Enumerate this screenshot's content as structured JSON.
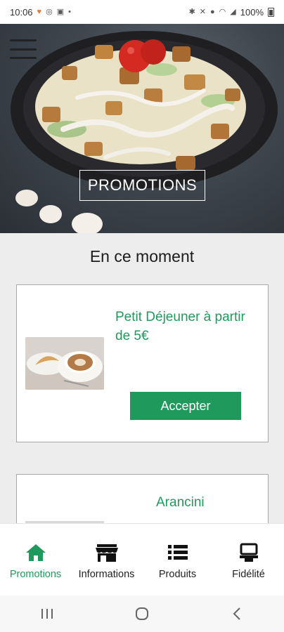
{
  "status_bar": {
    "time": "10:06",
    "battery": "100%",
    "left_icons": [
      "heart-icon",
      "whatsapp-icon",
      "image-icon",
      "dot-icon"
    ],
    "right_icons": [
      "bluetooth-icon",
      "mute-icon",
      "location-icon",
      "wifi-icon",
      "signal-icon",
      "battery-icon"
    ]
  },
  "hero": {
    "title": "PROMOTIONS",
    "menu_icon": "hamburger-menu-icon"
  },
  "section": {
    "title": "En ce moment"
  },
  "promotions": [
    {
      "title": "Petit Déjeuner à partir de 5€",
      "button_label": "Accepter",
      "image": "coffee-and-croissant"
    },
    {
      "title": "Arancini"
    }
  ],
  "tab_bar": {
    "tabs": [
      {
        "label": "Promotions",
        "icon": "home-icon",
        "active": true
      },
      {
        "label": "Informations",
        "icon": "store-icon",
        "active": false
      },
      {
        "label": "Produits",
        "icon": "list-icon",
        "active": false
      },
      {
        "label": "Fidélité",
        "icon": "register-icon",
        "active": false
      }
    ]
  },
  "nav_bar": {
    "buttons": [
      "recents-icon",
      "home-circle-icon",
      "back-icon"
    ]
  },
  "colors": {
    "accent": "#1f9a5c",
    "background": "#ededed",
    "card_border": "#a9a9a9"
  }
}
